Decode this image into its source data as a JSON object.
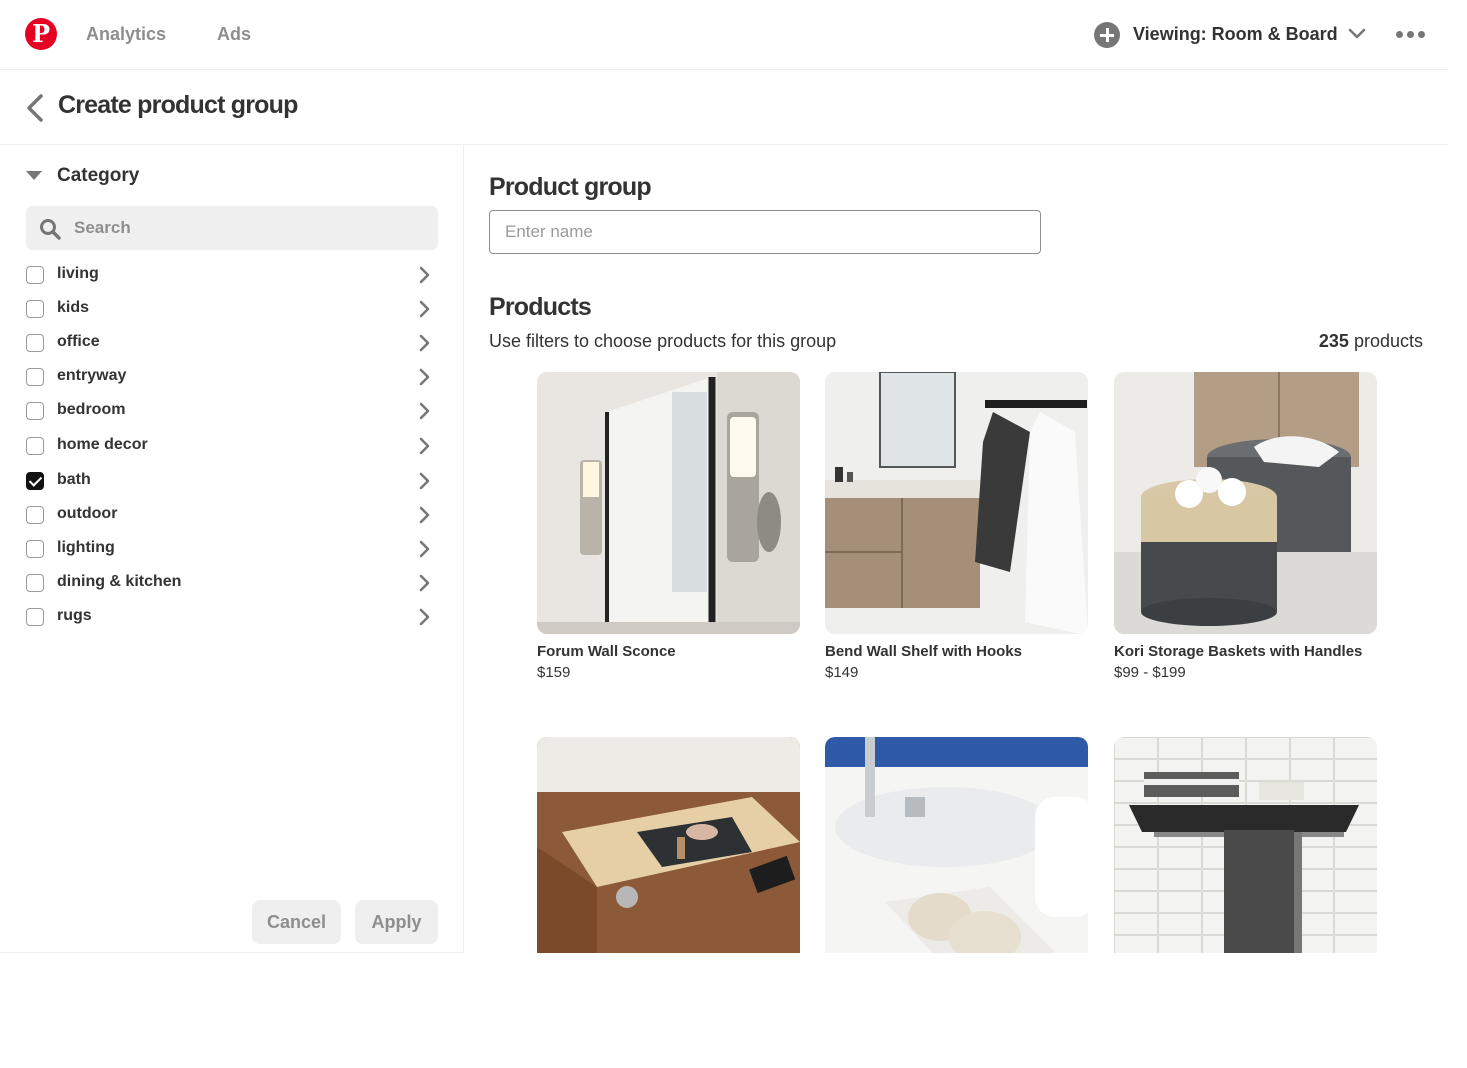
{
  "topbar": {
    "nav": [
      {
        "label": "Analytics"
      },
      {
        "label": "Ads"
      }
    ],
    "viewing_label": "Viewing: Room & Board"
  },
  "header": {
    "title": "Create product group"
  },
  "sidebar": {
    "category_title": "Category",
    "search_placeholder": "Search",
    "categories": [
      {
        "label": "living",
        "checked": false
      },
      {
        "label": "kids",
        "checked": false
      },
      {
        "label": "office",
        "checked": false
      },
      {
        "label": "entryway",
        "checked": false
      },
      {
        "label": "bedroom",
        "checked": false
      },
      {
        "label": "home decor",
        "checked": false
      },
      {
        "label": "bath",
        "checked": true
      },
      {
        "label": "outdoor",
        "checked": false
      },
      {
        "label": "lighting",
        "checked": false
      },
      {
        "label": "dining & kitchen",
        "checked": false
      },
      {
        "label": "rugs",
        "checked": false
      }
    ],
    "cancel_label": "Cancel",
    "apply_label": "Apply"
  },
  "main": {
    "product_group_title": "Product group",
    "name_placeholder": "Enter name",
    "products_title": "Products",
    "products_subtitle": "Use filters to choose products for this group",
    "products_count": "235",
    "products_count_suffix": " products",
    "products": [
      {
        "title": "Forum Wall Sconce",
        "price": "$159"
      },
      {
        "title": "Bend Wall Shelf with Hooks",
        "price": "$149"
      },
      {
        "title": "Kori Storage Baskets with Handles",
        "price": "$99 - $199"
      },
      {
        "title": "",
        "price": ""
      },
      {
        "title": "",
        "price": ""
      },
      {
        "title": "",
        "price": ""
      }
    ]
  },
  "colors": {
    "brand": "#e60023",
    "text": "#333333",
    "muted": "#8e8e8e"
  }
}
